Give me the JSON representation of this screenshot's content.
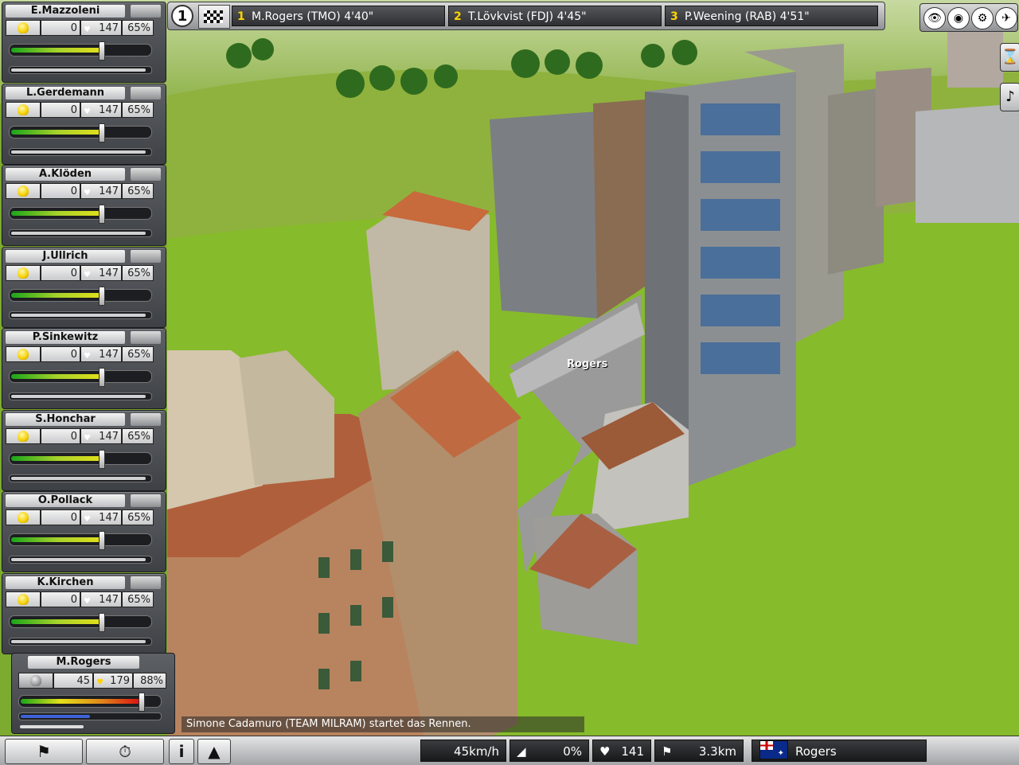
{
  "riders": [
    {
      "name": "E.Mazzoleni",
      "attack": "0",
      "hr": "147",
      "pct": "65%",
      "energy": 0.66,
      "reserve": 0.97
    },
    {
      "name": "L.Gerdemann",
      "attack": "0",
      "hr": "147",
      "pct": "65%",
      "energy": 0.66,
      "reserve": 0.97
    },
    {
      "name": "A.Klöden",
      "attack": "0",
      "hr": "147",
      "pct": "65%",
      "energy": 0.66,
      "reserve": 0.97
    },
    {
      "name": "J.Ullrich",
      "attack": "0",
      "hr": "147",
      "pct": "65%",
      "energy": 0.66,
      "reserve": 0.97
    },
    {
      "name": "P.Sinkewitz",
      "attack": "0",
      "hr": "147",
      "pct": "65%",
      "energy": 0.66,
      "reserve": 0.97
    },
    {
      "name": "S.Honchar",
      "attack": "0",
      "hr": "147",
      "pct": "65%",
      "energy": 0.66,
      "reserve": 0.97
    },
    {
      "name": "O.Pollack",
      "attack": "0",
      "hr": "147",
      "pct": "65%",
      "energy": 0.66,
      "reserve": 0.97
    },
    {
      "name": "K.Kirchen",
      "attack": "0",
      "hr": "147",
      "pct": "65%",
      "energy": 0.66,
      "reserve": 0.97
    }
  ],
  "leader": {
    "name": "M.Rogers",
    "attack": "45",
    "hr": "179",
    "pct": "88%",
    "energy": 0.95,
    "reserve": 0.5
  },
  "topbar": {
    "position": "1",
    "standings": [
      {
        "rank": "1",
        "text": "M.Rogers (TMO) 4'40\""
      },
      {
        "rank": "2",
        "text": "T.Lövkvist (FDJ) 4'45\""
      },
      {
        "rank": "3",
        "text": "P.Weening (RAB) 4'51\""
      }
    ]
  },
  "message": "Simone Cadamuro (TEAM MILRAM) startet das Rennen.",
  "scene_label": "Rogers",
  "bottom": {
    "speed": "45km/h",
    "gradient": "0%",
    "heart_rate": "141",
    "distance": "3.3km",
    "rider": "Rogers",
    "info_label": "i"
  }
}
